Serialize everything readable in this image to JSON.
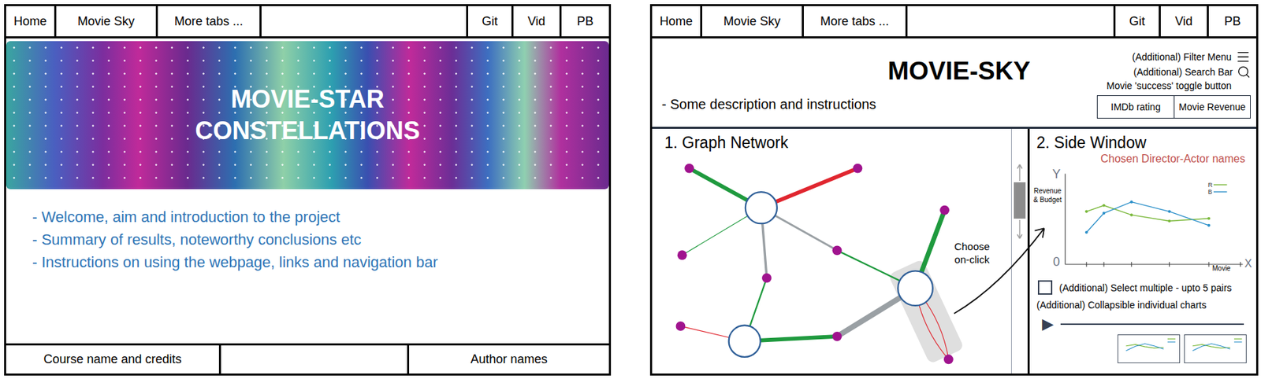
{
  "nav": {
    "left": [
      {
        "label": "Home"
      },
      {
        "label": "Movie Sky"
      },
      {
        "label": "More tabs ..."
      }
    ],
    "right": [
      {
        "label": "Git"
      },
      {
        "label": "Vid"
      },
      {
        "label": "PB"
      }
    ]
  },
  "home_page": {
    "banner": {
      "title": "MOVIE-STAR CONSTELLATIONS"
    },
    "bullets": [
      "- Welcome, aim and introduction to the project",
      "- Summary of results, noteworthy conclusions etc",
      "- Instructions on using the webpage, links and navigation bar"
    ],
    "footer": {
      "left": "Course name and credits",
      "right": "Author names"
    }
  },
  "movie_sky_page": {
    "header": {
      "title": "MOVIE-SKY",
      "description": "- Some description and instructions",
      "filter_menu": "(Additional) Filter Menu",
      "search_bar": "(Additional) Search Bar",
      "toggle": {
        "label": "Movie 'success' toggle button",
        "options": [
          {
            "label": "IMDb rating"
          },
          {
            "label": "Movie Revenue"
          }
        ]
      }
    },
    "graph": {
      "title": "1. Graph Network",
      "hint": "Choose on-click",
      "nodes": [
        {
          "kind": "director",
          "highlighted": false
        },
        {
          "kind": "director",
          "highlighted": true
        },
        {
          "kind": "director",
          "highlighted": false
        },
        {
          "kind": "actor",
          "highlighted": false
        },
        {
          "kind": "actor",
          "highlighted": false
        },
        {
          "kind": "actor",
          "highlighted": false
        },
        {
          "kind": "actor",
          "highlighted": false
        },
        {
          "kind": "actor",
          "highlighted": false
        },
        {
          "kind": "actor",
          "highlighted": false
        },
        {
          "kind": "actor",
          "highlighted": false
        },
        {
          "kind": "actor",
          "highlighted": false
        },
        {
          "kind": "actor",
          "highlighted": false
        }
      ],
      "edges": [
        {
          "color": "#1f9a3e",
          "weight": 5
        },
        {
          "color": "#e0262f",
          "weight": 5
        },
        {
          "color": "#1f9a3e",
          "weight": 1
        },
        {
          "color": "#9aa0a4",
          "weight": 2.5
        },
        {
          "color": "#9aa0a4",
          "weight": 3
        },
        {
          "color": "#1f9a3e",
          "weight": 2
        },
        {
          "color": "#1f9a3e",
          "weight": 2
        },
        {
          "color": "#1f9a3e",
          "weight": 6
        },
        {
          "color": "#9aa0a4",
          "weight": 7
        },
        {
          "color": "#1f9a3e",
          "weight": 5
        },
        {
          "color": "#e0262f",
          "weight": 1
        },
        {
          "color": "#e0262f",
          "weight": 1
        },
        {
          "color": "#e0262f",
          "weight": 1
        }
      ]
    },
    "side_window": {
      "title": "2. Side Window",
      "subtitle": "Chosen Director-Actor names",
      "chart": {
        "y_label": "Y",
        "y_title": "Revenue & Budget",
        "origin": "0",
        "x_title": "Movie",
        "x_label": "X",
        "series": [
          {
            "name": "R",
            "color": "#7ab83a",
            "values": [
              6.1,
              6.8,
              5.7,
              5.0,
              5.3
            ]
          },
          {
            "name": "B",
            "color": "#2a8fc9",
            "values": [
              3.7,
              5.9,
              7.2,
              6.1,
              4.5
            ]
          }
        ]
      },
      "select_multiple": {
        "label": "(Additional) Select multiple - upto 5 pairs",
        "checked": false
      },
      "collapsible_label": "(Additional) Collapsible individual charts",
      "player": {
        "icon": "▶"
      },
      "thumbnails": [
        {
          "series": [
            {
              "color": "#7ab83a",
              "values": [
                6.1,
                6.8,
                5.7,
                5.0,
                5.3
              ]
            },
            {
              "color": "#2a8fc9",
              "values": [
                3.7,
                5.9,
                7.2,
                6.1,
                4.5
              ]
            }
          ]
        },
        {
          "series": [
            {
              "color": "#7ab83a",
              "values": [
                6.1,
                6.8,
                5.7,
                5.0,
                5.3
              ]
            },
            {
              "color": "#2a8fc9",
              "values": [
                3.7,
                5.9,
                7.2,
                6.1,
                4.5
              ]
            }
          ]
        }
      ]
    }
  }
}
